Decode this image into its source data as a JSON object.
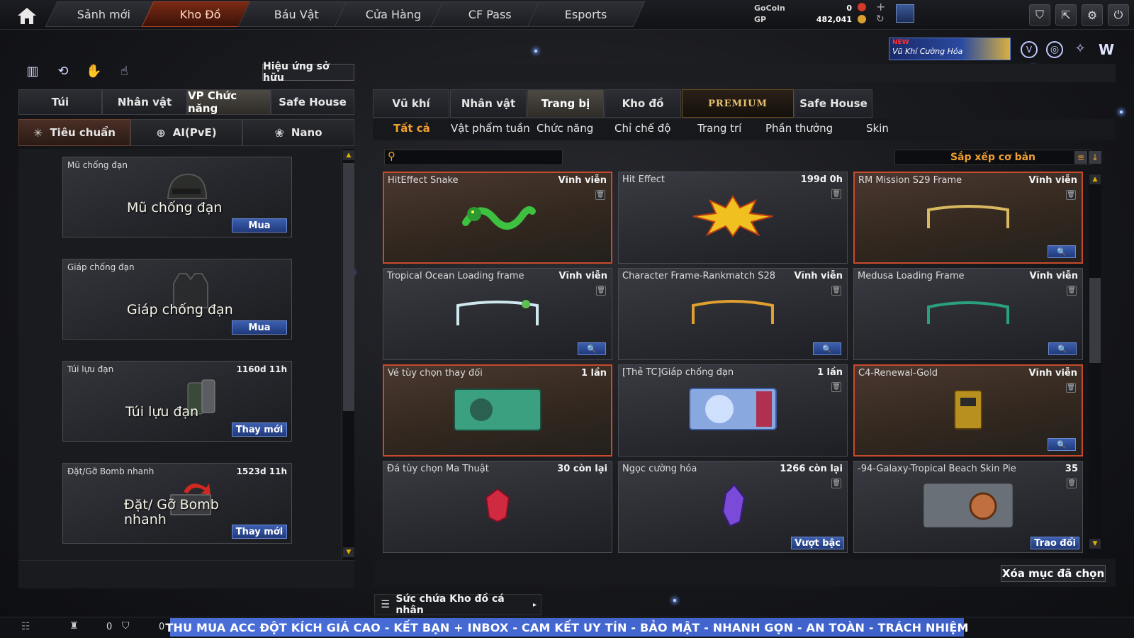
{
  "nav": {
    "tabs": [
      "Sảnh mới",
      "Kho Đồ",
      "Báu Vật",
      "Cửa Hàng",
      "CF Pass",
      "Esports"
    ],
    "active_index": 1
  },
  "currency": {
    "gocoin_label": "GoCoin",
    "gocoin_value": "0",
    "gp_label": "GP",
    "gp_value": "482,041"
  },
  "promo": {
    "new_badge": "NEW",
    "title": "Vũ Khí Cường Hóa"
  },
  "left": {
    "effect_button": "Hiệu ứng sở hữu",
    "tabs": [
      "Túi",
      "Nhân vật",
      "VP Chức năng",
      "Safe House"
    ],
    "active_tab": 2,
    "subtabs": [
      "Tiêu chuẩn",
      "AI(PvE)",
      "Nano"
    ],
    "active_subtab": 0,
    "items": [
      {
        "name": "Mũ chống đạn",
        "time": "",
        "big": "Mũ chống đạn",
        "action": "Mua"
      },
      {
        "name": "Giáp chống đạn",
        "time": "",
        "big": "Giáp chống đạn",
        "action": "Mua"
      },
      {
        "name": "Túi lựu đạn",
        "time": "1160d 11h",
        "big": "Túi lựu đạn",
        "action": "Thay mới"
      },
      {
        "name": "Đặt/Gỡ Bomb nhanh",
        "time": "1523d 11h",
        "big": "Đặt/ Gỡ Bomb nhanh",
        "action": "Thay mới"
      }
    ]
  },
  "right": {
    "tabs": [
      "Vũ khí",
      "Nhân vật",
      "Trang bị",
      "Kho đồ",
      "PREMIUM",
      "Safe House"
    ],
    "active_tab": 2,
    "filters": [
      "Tất cả",
      "Vật phẩm tuần",
      "Chức năng",
      "Chỉ chế độ",
      "Trang trí",
      "Phần thưởng",
      "Skin"
    ],
    "active_filter": 0,
    "sort_label": "Sắp xếp cơ bản",
    "items": [
      {
        "name": "HitEffect Snake",
        "duration": "Vĩnh viễn",
        "highlight": true,
        "zoom": false,
        "action": ""
      },
      {
        "name": "Hit Effect",
        "duration": "199d 0h",
        "highlight": false,
        "zoom": false,
        "action": ""
      },
      {
        "name": "RM Mission S29 Frame",
        "duration": "Vĩnh viễn",
        "highlight": true,
        "zoom": true,
        "action": ""
      },
      {
        "name": "Tropical Ocean Loading frame",
        "duration": "Vĩnh viễn",
        "highlight": false,
        "zoom": true,
        "action": ""
      },
      {
        "name": "Character Frame-Rankmatch S28",
        "duration": "Vĩnh viễn",
        "highlight": false,
        "zoom": true,
        "action": ""
      },
      {
        "name": "Medusa Loading Frame",
        "duration": "Vĩnh viễn",
        "highlight": false,
        "zoom": true,
        "action": ""
      },
      {
        "name": "Vé tùy chọn thay đổi",
        "duration": "1 lần",
        "highlight": true,
        "zoom": false,
        "action": ""
      },
      {
        "name": "[Thẻ TC]Giáp chống đạn",
        "duration": "1 lần",
        "highlight": false,
        "zoom": false,
        "action": ""
      },
      {
        "name": "C4-Renewal-Gold",
        "duration": "Vĩnh viễn",
        "highlight": true,
        "zoom": true,
        "action": ""
      },
      {
        "name": "Đá tùy chọn Ma Thuật",
        "duration": "30 còn lại",
        "highlight": false,
        "zoom": false,
        "action": ""
      },
      {
        "name": "Ngọc cường hóa",
        "duration": "1266 còn lại",
        "highlight": false,
        "zoom": false,
        "action": "Vượt bậc"
      },
      {
        "name": "-94-Galaxy-Tropical Beach Skin Pie",
        "duration": "35",
        "highlight": false,
        "zoom": false,
        "action": "Trao đổi"
      }
    ],
    "delete_button": "Xóa mục đã chọn",
    "capacity_label": "Sức chứa Kho đồ cá nhân"
  },
  "bottom": {
    "count_a": "0",
    "count_b": "0",
    "banner": "THU MUA ACC ĐỘT KÍCH GIÁ CAO  -  KẾT BẠN + INBOX  -  CAM KẾT UY TÍN - BẢO MẬT - NHANH GỌN - AN TOÀN - TRÁCH NHIỆM"
  },
  "colors": {
    "accent_orange": "#f0a030",
    "highlight_border": "#c64a2c",
    "button_blue": "#3c5fb0",
    "banner_blue": "#4a6fd8"
  }
}
